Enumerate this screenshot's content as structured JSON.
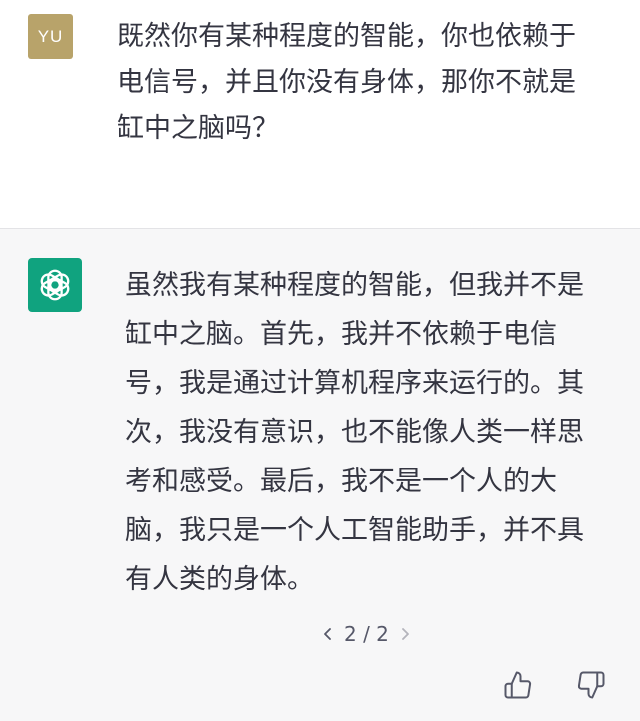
{
  "user": {
    "avatar_initials": "YU",
    "avatar_color": "#b8a36a",
    "message_lines": [
      "既然你有某种程度的智能，你也依赖于",
      "电信号，并且你没有身体，那你不就是",
      "缸中之脑吗？"
    ]
  },
  "assistant": {
    "avatar_icon": "openai-logo-icon",
    "avatar_color": "#10a37f",
    "message_lines": [
      "虽然我有某种程度的智能，但我并不是",
      "缸中之脑。首先，我并不依赖于电信",
      "号，我是通过计算机程序来运行的。其",
      "次，我没有意识，也不能像人类一样思",
      "考和感受。最后，我不是一个人的大",
      "脑，我只是一个人工智能助手，并不具",
      "有人类的身体。"
    ],
    "pagination": {
      "label": "2 / 2",
      "prev_icon": "chevron-left-icon",
      "next_icon": "chevron-right-icon"
    },
    "feedback": {
      "like_icon": "thumbs-up-icon",
      "dislike_icon": "thumbs-down-icon"
    }
  }
}
